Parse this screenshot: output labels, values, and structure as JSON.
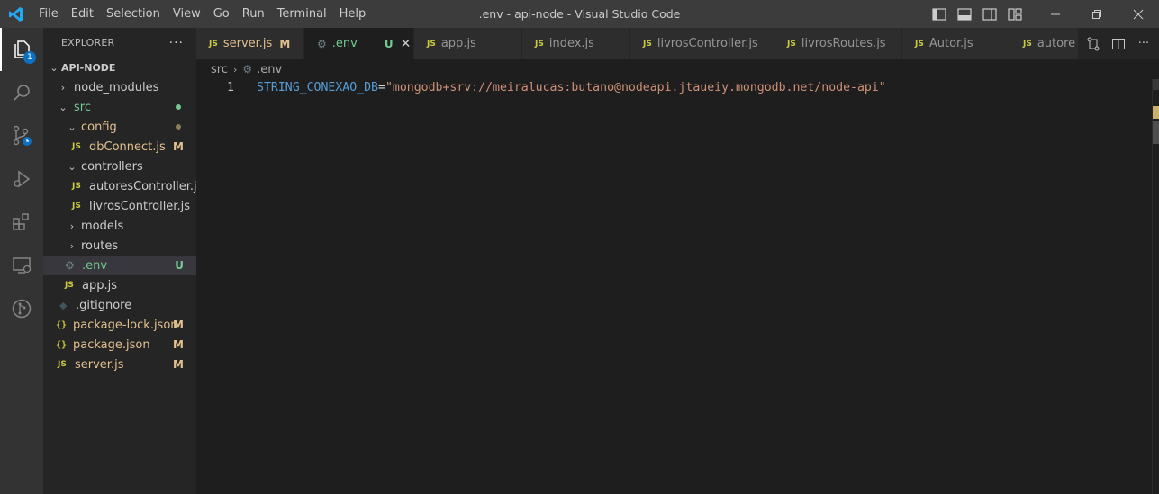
{
  "app": {
    "window_title": ".env - api-node - Visual Studio Code",
    "menu": [
      "File",
      "Edit",
      "Selection",
      "View",
      "Go",
      "Run",
      "Terminal",
      "Help"
    ]
  },
  "activity_bar": {
    "explorer_badge": "1",
    "items": [
      "explorer-icon",
      "search-icon",
      "source-control-icon",
      "run-debug-icon",
      "extensions-icon",
      "remote-explorer-icon",
      "git-graph-icon"
    ]
  },
  "sidebar": {
    "title": "EXPLORER",
    "more": "···",
    "project": "API-NODE",
    "tree": [
      {
        "label": "node_modules",
        "type": "folder",
        "expanded": false,
        "status": ""
      },
      {
        "label": "src",
        "type": "folder",
        "expanded": true,
        "status": "dot"
      },
      {
        "label": "config",
        "type": "folder",
        "expanded": true,
        "status": "dot"
      },
      {
        "label": "dbConnect.js",
        "type": "js",
        "status": "M"
      },
      {
        "label": "controllers",
        "type": "folder",
        "expanded": true,
        "status": ""
      },
      {
        "label": "autoresController.js",
        "type": "js",
        "status": ""
      },
      {
        "label": "livrosController.js",
        "type": "js",
        "status": ""
      },
      {
        "label": "models",
        "type": "folder",
        "expanded": false,
        "status": ""
      },
      {
        "label": "routes",
        "type": "folder",
        "expanded": false,
        "status": ""
      },
      {
        "label": ".env",
        "type": "env",
        "status": "U"
      },
      {
        "label": "app.js",
        "type": "js",
        "status": ""
      },
      {
        "label": ".gitignore",
        "type": "git",
        "status": ""
      },
      {
        "label": "package-lock.json",
        "type": "json",
        "status": "M"
      },
      {
        "label": "package.json",
        "type": "json",
        "status": "M"
      },
      {
        "label": "server.js",
        "type": "js",
        "status": "M"
      }
    ]
  },
  "tabs": [
    {
      "label": "server.js",
      "icon": "JS",
      "status": "M"
    },
    {
      "label": ".env",
      "icon": "gear",
      "status": "U",
      "active": true
    },
    {
      "label": "app.js",
      "icon": "JS",
      "status": ""
    },
    {
      "label": "index.js",
      "icon": "JS",
      "status": ""
    },
    {
      "label": "livrosController.js",
      "icon": "JS",
      "status": ""
    },
    {
      "label": "livrosRoutes.js",
      "icon": "JS",
      "status": ""
    },
    {
      "label": "Autor.js",
      "icon": "JS",
      "status": ""
    },
    {
      "label": "autore",
      "icon": "JS",
      "status": ""
    }
  ],
  "breadcrumb": {
    "folder": "src",
    "file": ".env"
  },
  "editor": {
    "lines": [
      {
        "number": "1",
        "key": "STRING_CONEXAO_DB",
        "eq": "=",
        "value": "\"mongodb+srv://meiralucas:butano@nodeapi.jtaueiy.mongodb.net/node-api\""
      }
    ]
  },
  "colors": {
    "modified": "#e2c08d",
    "untracked": "#73c991",
    "js_icon": "#cbcb41",
    "badge": "#0e70c0"
  }
}
